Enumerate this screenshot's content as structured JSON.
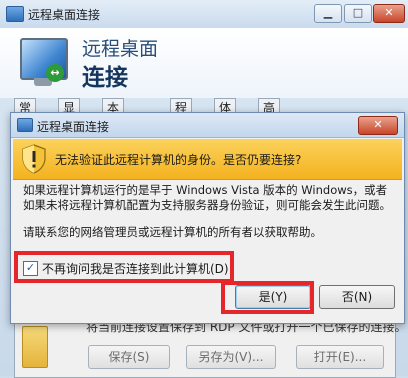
{
  "background_window": {
    "title": "远程桌面连接",
    "window_buttons": {
      "minimize": "▁",
      "maximize": "□",
      "close": "✕"
    },
    "header": {
      "line1": "远程桌面",
      "line2": "连接"
    },
    "tabs": [
      "常规",
      "显示",
      "本地资源",
      "程序",
      "体验",
      "高级"
    ],
    "panel_text": "将当前连接设置保存到 RDP 文件或打开一个已保存的连接。",
    "buttons": {
      "save": "保存(S)",
      "save_as": "另存为(V)...",
      "open": "打开(E)..."
    }
  },
  "dialog": {
    "title": "远程桌面连接",
    "close": "✕",
    "warning_text": "无法验证此远程计算机的身份。是否仍要连接?",
    "paragraph1": "如果远程计算机运行的是早于 Windows Vista 版本的 Windows，或者如果未将远程计算机配置为支持服务器身份验证，则可能会发生此问题。",
    "paragraph2": "请联系您的网络管理员或远程计算机的所有者以获取帮助。",
    "checkbox_label": "不再询问我是否连接到此计算机(D)",
    "checkbox_checked": true,
    "checkmark": "✓",
    "yes_button": "是(Y)",
    "no_button": "否(N)"
  },
  "colors": {
    "highlight": "#e5262a",
    "warning_band": "#f4b21f",
    "accent": "#2a4e78"
  }
}
